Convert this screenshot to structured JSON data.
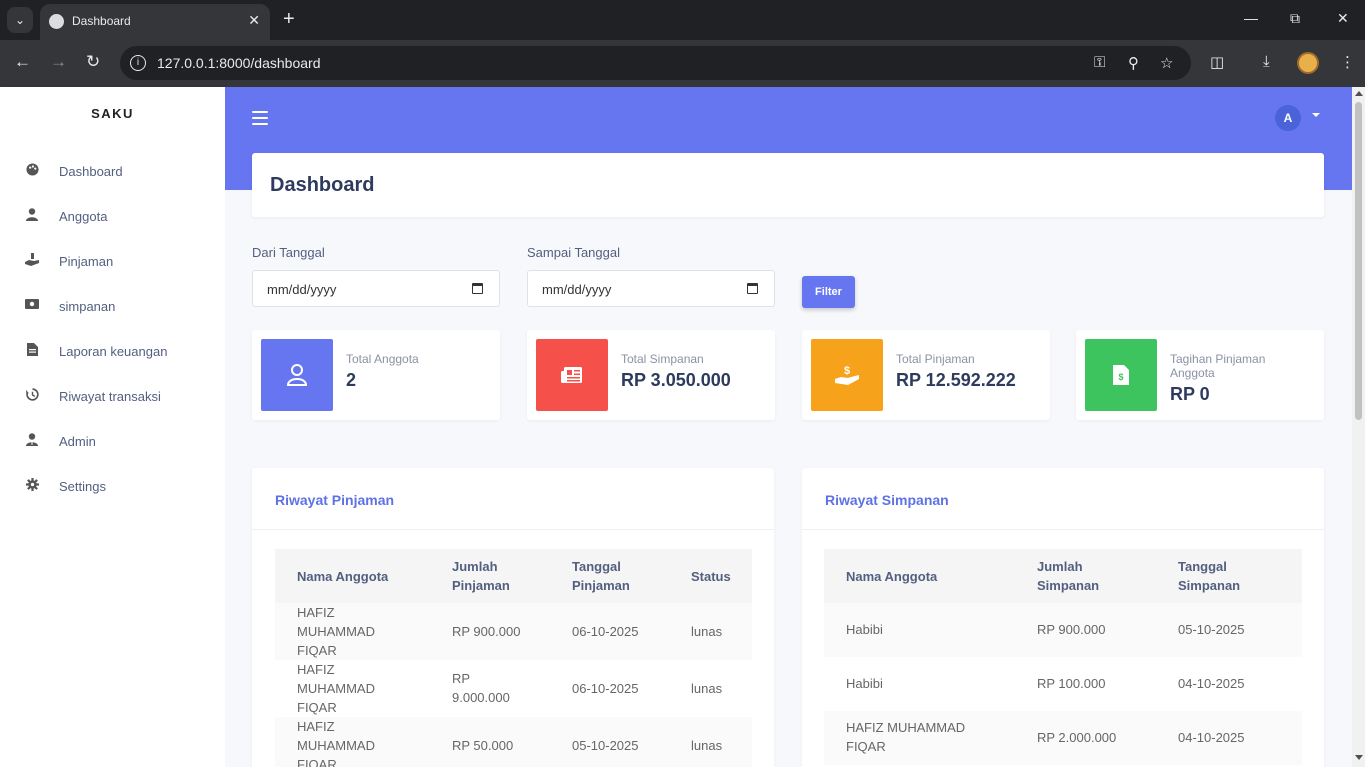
{
  "browser": {
    "tab_title": "Dashboard",
    "url": "127.0.0.1:8000/dashboard"
  },
  "sidebar": {
    "brand": "SAKU",
    "items": [
      {
        "label": "Dashboard",
        "icon": "palette-icon"
      },
      {
        "label": "Anggota",
        "icon": "user-icon"
      },
      {
        "label": "Pinjaman",
        "icon": "hand-coin-icon"
      },
      {
        "label": "simpanan",
        "icon": "money-icon"
      },
      {
        "label": "Laporan keuangan",
        "icon": "file-icon"
      },
      {
        "label": "Riwayat transaksi",
        "icon": "history-icon"
      },
      {
        "label": "Admin",
        "icon": "user-tie-icon"
      },
      {
        "label": "Settings",
        "icon": "gear-icon"
      }
    ]
  },
  "header": {
    "user_initial": "A"
  },
  "page": {
    "title": "Dashboard"
  },
  "filter": {
    "from_label": "Dari Tanggal",
    "from_value": "mm/dd/yyyy",
    "to_label": "Sampai Tanggal",
    "to_value": "mm/dd/yyyy",
    "button": "Filter"
  },
  "stats": [
    {
      "label": "Total Anggota",
      "value": "2",
      "color": "#6675f0",
      "icon": "user-icon"
    },
    {
      "label": "Total Simpanan",
      "value": "RP 3.050.000",
      "color": "#f5504a",
      "icon": "newspaper-icon"
    },
    {
      "label": "Total Pinjaman",
      "value": "RP 12.592.222",
      "color": "#f7a21b",
      "icon": "hand-dollar-icon"
    },
    {
      "label": "Tagihan Pinjaman Anggota",
      "label_line1": "Tagihan Pinjaman",
      "label_line2": "Anggota",
      "value": "RP 0",
      "color": "#3ec45f",
      "icon": "invoice-icon"
    }
  ],
  "pinjaman": {
    "title": "Riwayat Pinjaman",
    "headers": {
      "nama": "Nama Anggota",
      "jumlah_1": "Jumlah",
      "jumlah_2": "Pinjaman",
      "tanggal_1": "Tanggal",
      "tanggal_2": "Pinjaman",
      "status": "Status"
    },
    "rows": [
      {
        "nama_1": "HAFIZ",
        "nama_2": "MUHAMMAD",
        "nama_3": "FIQAR",
        "jumlah_1": "RP 900.000",
        "jumlah_2": "",
        "tanggal": "06-10-2025",
        "status": "lunas"
      },
      {
        "nama_1": "HAFIZ",
        "nama_2": "MUHAMMAD",
        "nama_3": "FIQAR",
        "jumlah_1": "RP",
        "jumlah_2": "9.000.000",
        "tanggal": "06-10-2025",
        "status": "lunas"
      },
      {
        "nama_1": "HAFIZ",
        "nama_2": "MUHAMMAD",
        "nama_3": "FIQAR",
        "jumlah_1": "RP 50.000",
        "jumlah_2": "",
        "tanggal": "05-10-2025",
        "status": "lunas"
      }
    ]
  },
  "simpanan": {
    "title": "Riwayat Simpanan",
    "headers": {
      "nama": "Nama Anggota",
      "jumlah_1": "Jumlah",
      "jumlah_2": "Simpanan",
      "tanggal_1": "Tanggal",
      "tanggal_2": "Simpanan"
    },
    "rows": [
      {
        "nama_1": "Habibi",
        "nama_2": "",
        "jumlah": "RP 900.000",
        "tanggal": "05-10-2025"
      },
      {
        "nama_1": "Habibi",
        "nama_2": "",
        "jumlah": "RP 100.000",
        "tanggal": "04-10-2025"
      },
      {
        "nama_1": "HAFIZ MUHAMMAD",
        "nama_2": "FIQAR",
        "jumlah": "RP 2.000.000",
        "tanggal": "04-10-2025"
      }
    ]
  }
}
